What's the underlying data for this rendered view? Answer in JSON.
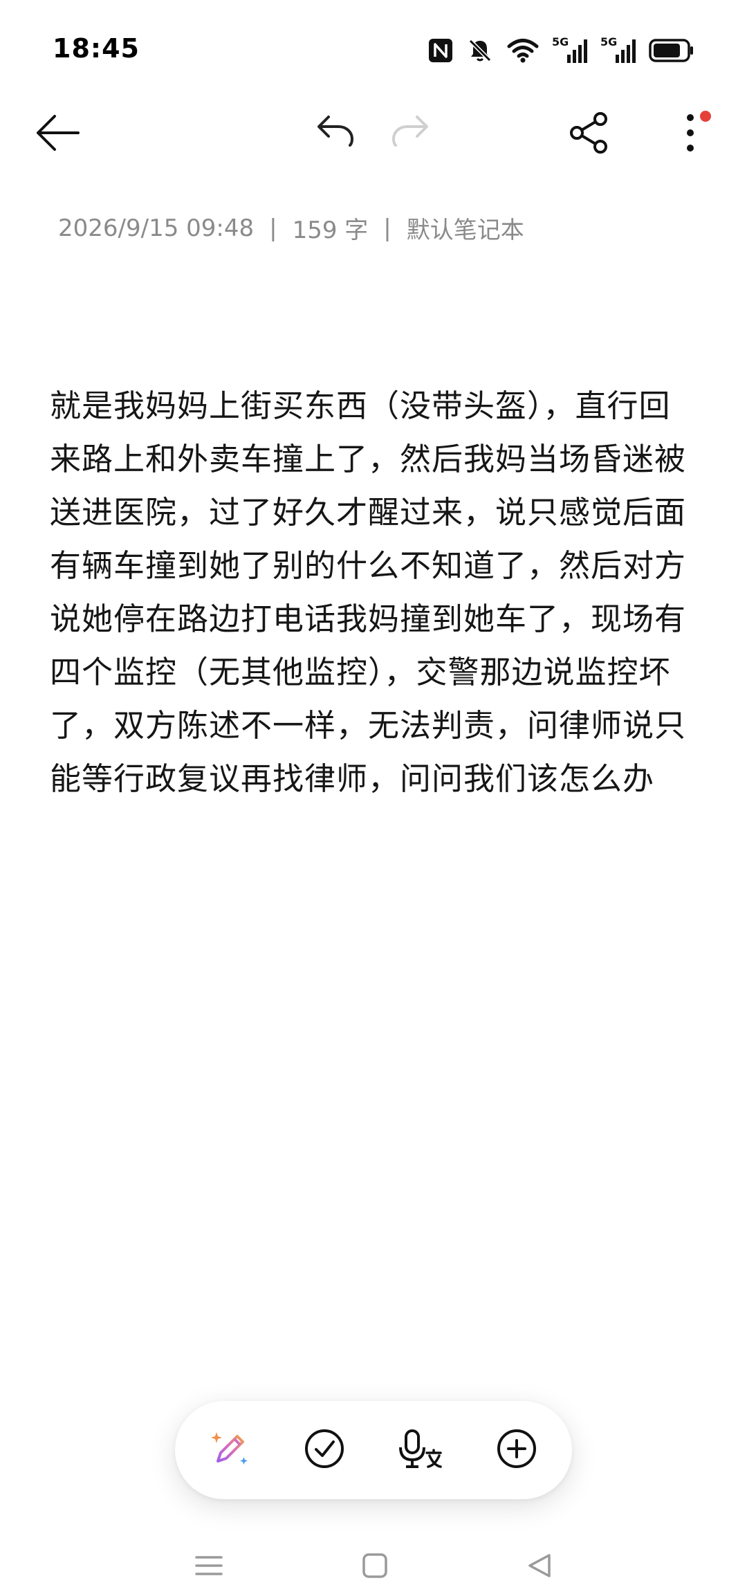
{
  "status_bar": {
    "time": "18:45",
    "icons": [
      "nfc-icon",
      "mute-bell-icon",
      "wifi-icon",
      "signal-5g-icon",
      "signal-5g-icon",
      "battery-icon"
    ],
    "signal_label_1": "5G",
    "signal_label_2": "5G"
  },
  "toolbar": {
    "icons": [
      "back-arrow-icon",
      "undo-icon",
      "redo-icon",
      "share-icon",
      "more-vertical-icon"
    ],
    "notification_dot_color": "#e5403a"
  },
  "note": {
    "date": "2026/9/15 09:48",
    "word_count": "159 字",
    "notebook": "默认笔记本",
    "separator": "|",
    "body": "就是我妈妈上街买东西（没带头盔），直行回来路上和外卖车撞上了，然后我妈当场昏迷被送进医院，过了好久才醒过来，说只感觉后面有辆车撞到她了别的什么不知道了，然后对方说她停在路边打电话我妈撞到她车了，现场有四个监控（无其他监控），交警那边说监控坏了，双方陈述不一样，无法判责，问律师说只能等行政复议再找律师，问问我们该怎么办"
  },
  "bottom_toolbar": {
    "icons": [
      "ai-pen-icon",
      "checklist-icon",
      "voice-to-text-icon",
      "add-icon"
    ]
  },
  "nav_bar": {
    "icons": [
      "menu-icon",
      "home-icon",
      "back-triangle-icon"
    ]
  }
}
